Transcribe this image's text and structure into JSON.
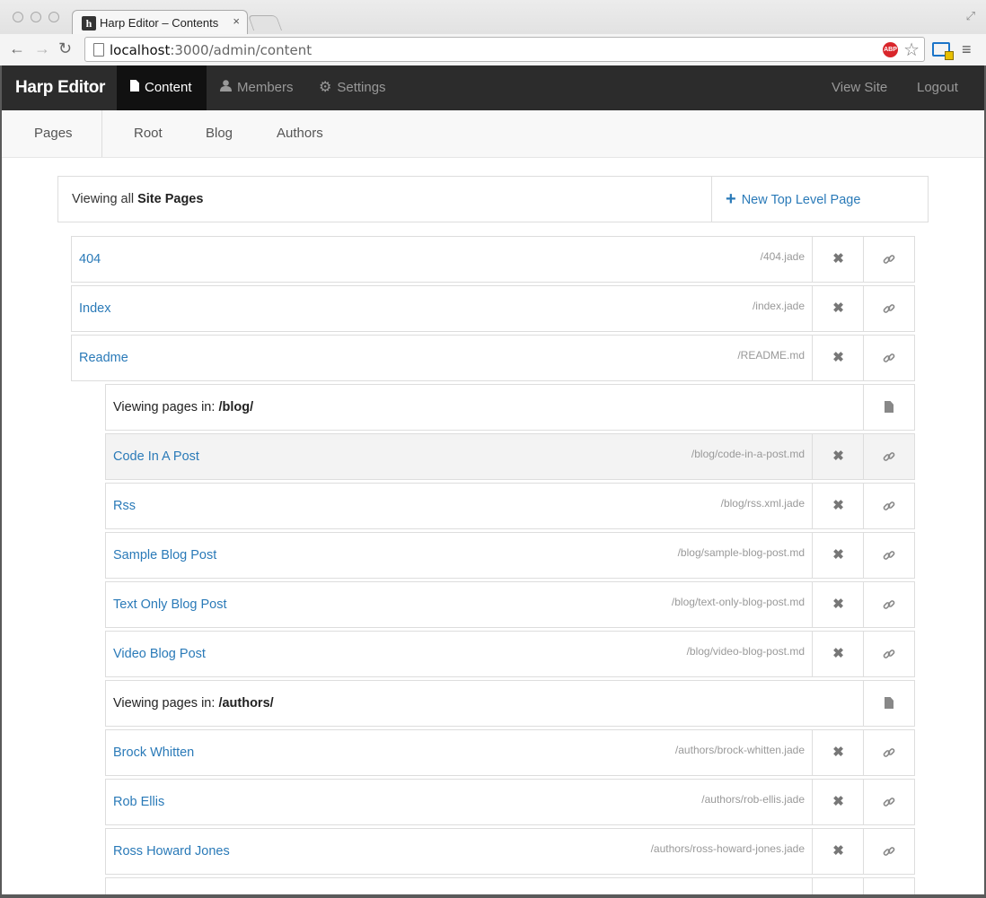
{
  "browser": {
    "tab_title": "Harp Editor – Contents",
    "tab_close": "×",
    "url_host": "localhost",
    "url_rest": ":3000/admin/content",
    "abp_label": "ABP",
    "icons": [
      "back-icon",
      "forward-icon",
      "reload-icon",
      "page-icon",
      "adblock-icon",
      "star-icon",
      "extension-icon",
      "menu-icon",
      "fullscreen-icon"
    ]
  },
  "navbar": {
    "brand": "Harp Editor",
    "items": [
      {
        "label": "Content",
        "icon": "file-icon",
        "active": true
      },
      {
        "label": "Members",
        "icon": "user-icon",
        "active": false
      },
      {
        "label": "Settings",
        "icon": "gear-icon",
        "active": false
      }
    ],
    "right_items": [
      {
        "label": "View Site"
      },
      {
        "label": "Logout"
      }
    ]
  },
  "subnav": {
    "pages_label": "Pages",
    "items": [
      "Root",
      "Blog",
      "Authors"
    ]
  },
  "header": {
    "prefix": "Viewing all",
    "bold": "Site Pages",
    "new_page_label": "New Top Level Page"
  },
  "pages": [
    {
      "title": "404",
      "path": "/404.jade"
    },
    {
      "title": "Index",
      "path": "/index.jade"
    },
    {
      "title": "Readme",
      "path": "/README.md"
    }
  ],
  "blog_folder": {
    "prefix": "Viewing pages in:",
    "folder": "/blog/"
  },
  "blog_pages": [
    {
      "title": "Code In A Post",
      "path": "/blog/code-in-a-post.md"
    },
    {
      "title": "Rss",
      "path": "/blog/rss.xml.jade"
    },
    {
      "title": "Sample Blog Post",
      "path": "/blog/sample-blog-post.md"
    },
    {
      "title": "Text Only Blog Post",
      "path": "/blog/text-only-blog-post.md"
    },
    {
      "title": "Video Blog Post",
      "path": "/blog/video-blog-post.md"
    }
  ],
  "authors_folder": {
    "prefix": "Viewing pages in:",
    "folder": "/authors/"
  },
  "author_pages": [
    {
      "title": "Brock Whitten",
      "path": "/authors/brock-whitten.jade"
    },
    {
      "title": "Rob Ellis",
      "path": "/authors/rob-ellis.jade"
    },
    {
      "title": "Ross Howard Jones",
      "path": "/authors/ross-howard-jones.jade"
    }
  ],
  "colors": {
    "link": "#2a7ab8",
    "navbar": "#2c2c2c",
    "active_nav": "#111111"
  }
}
